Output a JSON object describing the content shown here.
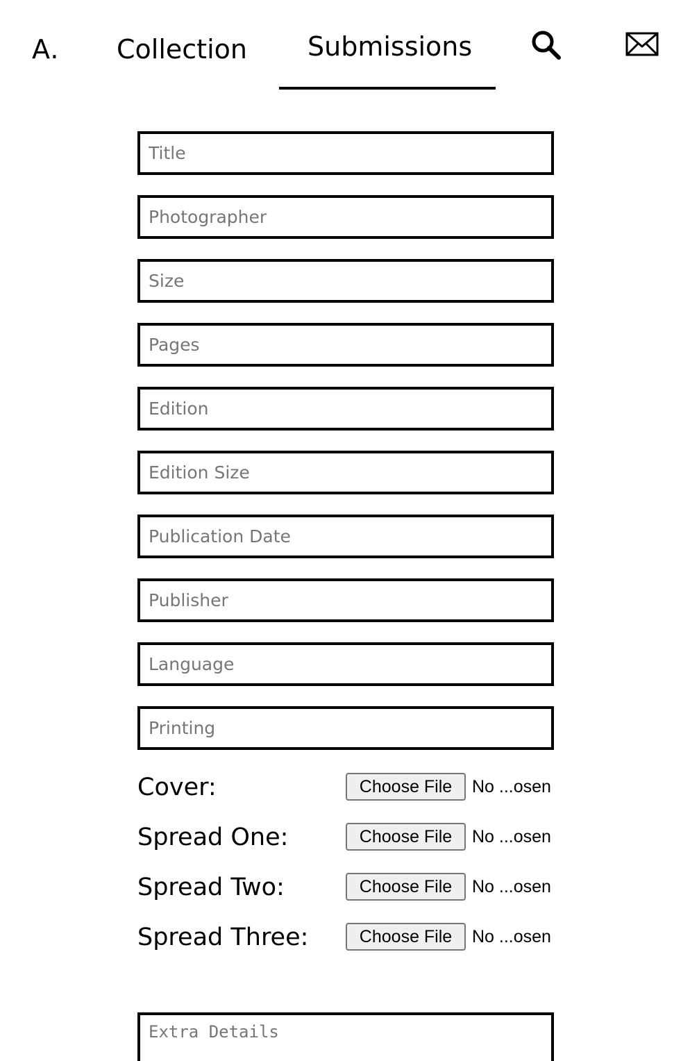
{
  "nav": {
    "brand": "A.",
    "links": [
      {
        "label": "Collection",
        "active": false
      },
      {
        "label": "Submissions",
        "active": true
      }
    ],
    "icons": [
      "search-icon",
      "mail-icon"
    ]
  },
  "form": {
    "fields": [
      {
        "placeholder": "Title",
        "value": ""
      },
      {
        "placeholder": "Photographer",
        "value": ""
      },
      {
        "placeholder": "Size",
        "value": ""
      },
      {
        "placeholder": "Pages",
        "value": ""
      },
      {
        "placeholder": "Edition",
        "value": ""
      },
      {
        "placeholder": "Edition Size",
        "value": ""
      },
      {
        "placeholder": "Publication Date",
        "value": ""
      },
      {
        "placeholder": "Publisher",
        "value": ""
      },
      {
        "placeholder": "Language",
        "value": ""
      },
      {
        "placeholder": "Printing",
        "value": ""
      }
    ],
    "file_inputs": [
      {
        "label": "Cover:",
        "button": "Choose File",
        "status": "No ...osen"
      },
      {
        "label": "Spread One:",
        "button": "Choose File",
        "status": "No ...osen"
      },
      {
        "label": "Spread Two:",
        "button": "Choose File",
        "status": "No ...osen"
      },
      {
        "label": "Spread Three:",
        "button": "Choose File",
        "status": "No ...osen"
      }
    ],
    "extra_details": {
      "placeholder": "Extra Details",
      "value": ""
    }
  },
  "colors": {
    "text": "#000000",
    "placeholder": "#767676",
    "file_button_bg": "#efefef",
    "file_button_border": "#767676"
  }
}
